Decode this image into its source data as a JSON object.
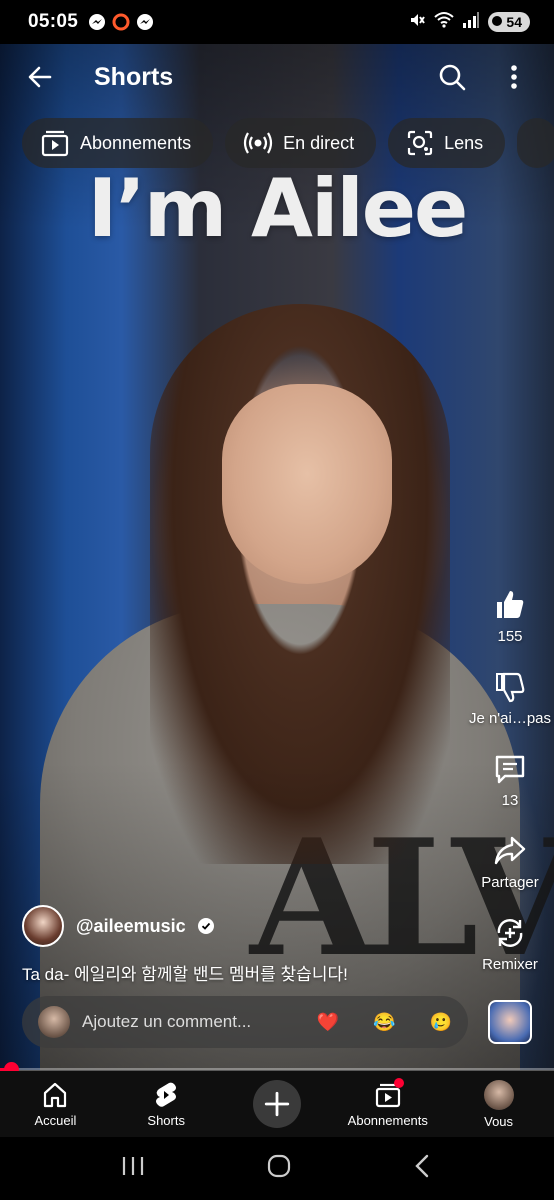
{
  "status_bar": {
    "time": "05:05",
    "left_icons": [
      "messenger-icon",
      "record-icon",
      "messenger-icon"
    ],
    "right_icons": [
      "mute-icon",
      "wifi-icon",
      "signal-icon"
    ],
    "battery": "54"
  },
  "header": {
    "title": "Shorts"
  },
  "chips": [
    {
      "label": "Abonnements",
      "icon": "subscriptions-icon"
    },
    {
      "label": "En direct",
      "icon": "live-icon"
    },
    {
      "label": "Lens",
      "icon": "lens-icon"
    }
  ],
  "video": {
    "overlay_title": "I’m Ailee"
  },
  "actions": {
    "like_count": "155",
    "dislike_label": "Je n'ai…pas",
    "comments_count": "13",
    "share_label": "Partager",
    "remix_label": "Remixer"
  },
  "channel": {
    "handle": "@aileemusic",
    "verified": true
  },
  "caption": "Ta da- 에일리와 함께할 밴드 멤버를 찾습니다!",
  "comment_bar": {
    "placeholder": "Ajoutez un comment...",
    "emojis": [
      "❤️",
      "😂",
      "🥲"
    ]
  },
  "progress": {
    "fraction": 0.02,
    "fill_color": "#ff0033"
  },
  "bottom_nav": [
    {
      "label": "Accueil",
      "icon": "home-icon"
    },
    {
      "label": "Shorts",
      "icon": "shorts-icon"
    },
    {
      "label": "",
      "icon": "create-icon"
    },
    {
      "label": "Abonnements",
      "icon": "subscriptions-icon"
    },
    {
      "label": "Vous",
      "icon": "avatar"
    }
  ],
  "accent_color": "#ff0033"
}
